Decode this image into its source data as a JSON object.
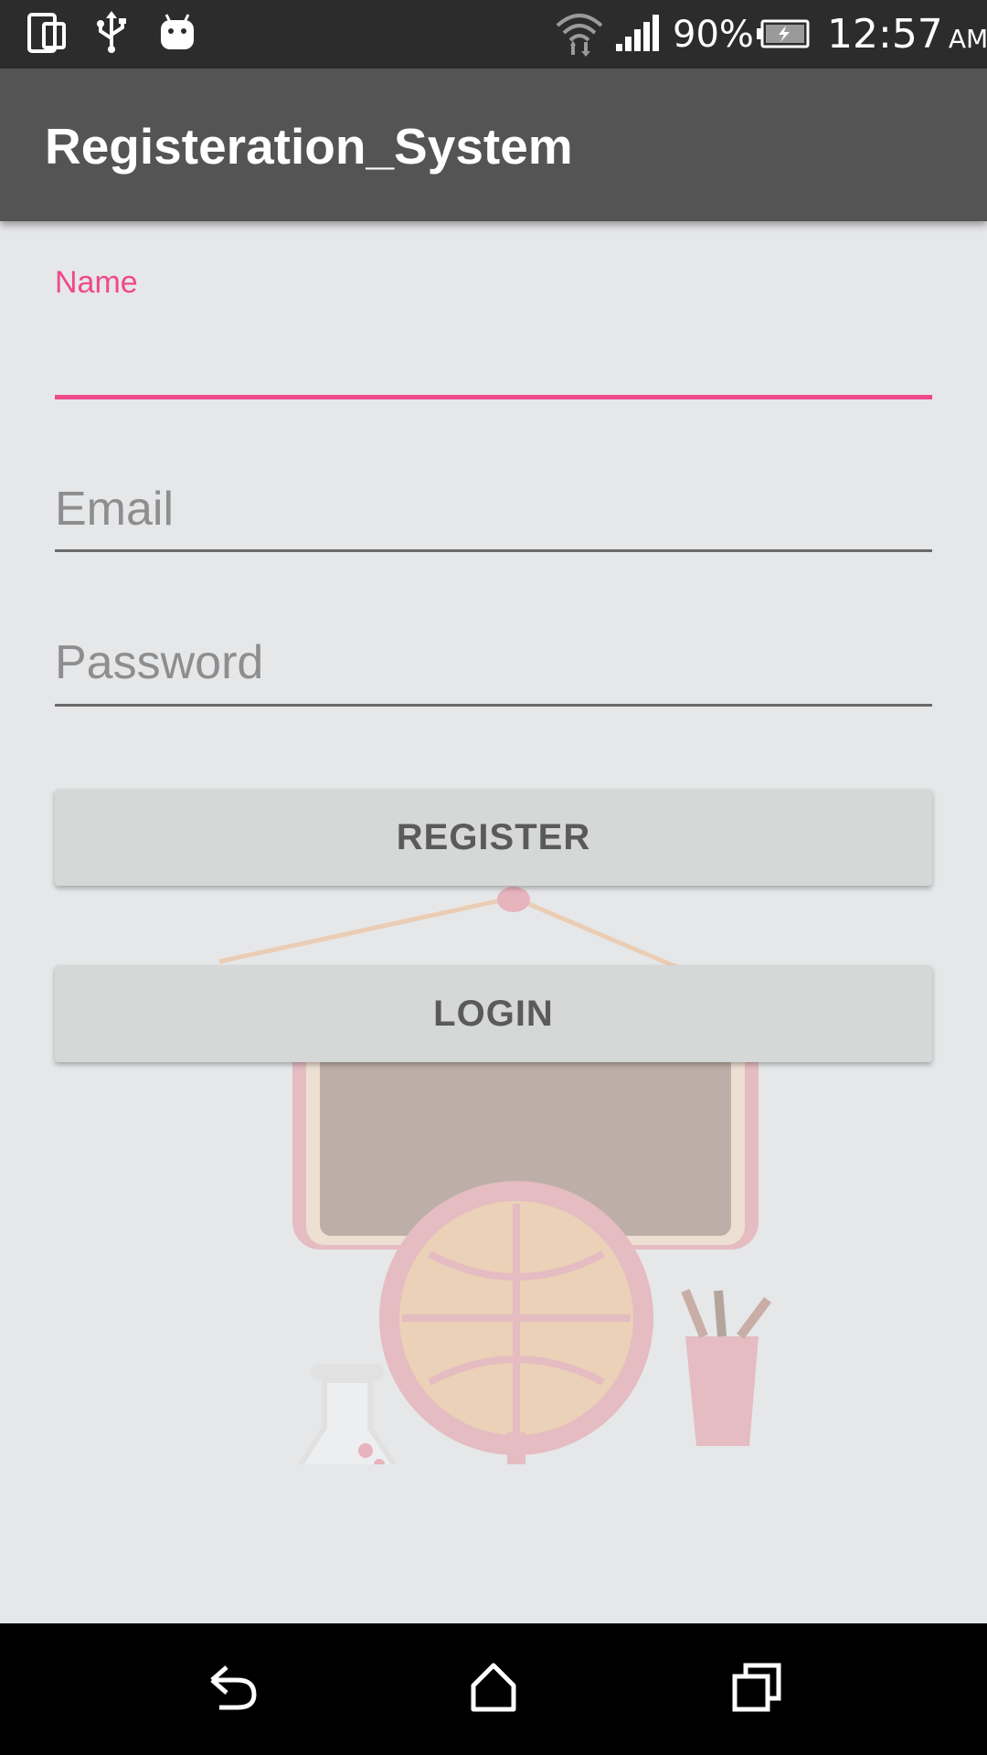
{
  "status_bar": {
    "battery_percent": "90%",
    "time": "12:57",
    "ampm": "AM"
  },
  "app_bar": {
    "title": "Registeration_System"
  },
  "form": {
    "name_label": "Name",
    "name_value": "",
    "email_placeholder": "Email",
    "password_placeholder": "Password",
    "register_label": "REGISTER",
    "login_label": "LOGIN"
  },
  "colors": {
    "accent": "#ee4a8a",
    "app_bar": "#545454",
    "status_bar": "#2c2c2c",
    "button": "#d6d7d7"
  },
  "icons": {
    "status_left": [
      "device-icon",
      "usb-icon",
      "android-icon"
    ],
    "status_right": [
      "wifi-icon",
      "signal-icon",
      "battery-charging-icon"
    ],
    "nav": [
      "back-icon",
      "home-icon",
      "recents-icon"
    ]
  }
}
